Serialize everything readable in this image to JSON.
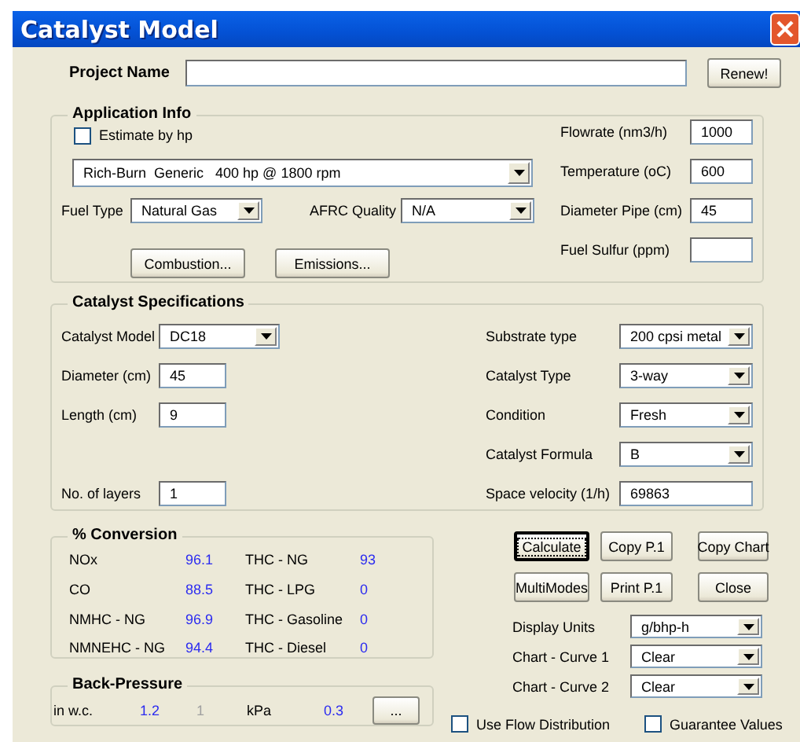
{
  "window": {
    "title": "Catalyst Model"
  },
  "project": {
    "label": "Project Name",
    "button": "Renew!"
  },
  "application_info": {
    "title": "Application Info",
    "estimate_by_hp": {
      "label": "Estimate by hp",
      "checked": false
    },
    "engine": {
      "value": "Rich-Burn  Generic   400 hp @ 1800 rpm"
    },
    "fuel_type": {
      "label": "Fuel Type",
      "value": "Natural Gas"
    },
    "afrc_quality": {
      "label": "AFRC Quality",
      "value": "N/A"
    },
    "buttons": [
      "Combustion...",
      "Emissions..."
    ],
    "fields": [
      {
        "label": "Flowrate (nm3/h)",
        "value": "1000"
      },
      {
        "label": "Temperature (oC)",
        "value": "600"
      },
      {
        "label": "Diameter Pipe (cm)",
        "value": "45"
      },
      {
        "label": "Fuel Sulfur (ppm)"
      }
    ]
  },
  "catalyst_specifications": {
    "title": "Catalyst Specifications",
    "left": [
      {
        "kind": "combo",
        "label": "Catalyst Model",
        "value": "DC18"
      },
      {
        "kind": "field",
        "label": "Diameter (cm)",
        "value": "45"
      },
      {
        "kind": "field",
        "label": "Length (cm)",
        "value": "9"
      },
      {
        "kind": "field",
        "label": "No. of layers",
        "value": "1"
      }
    ],
    "right": [
      {
        "kind": "combo",
        "label": "Substrate type",
        "value": "200 cpsi metal"
      },
      {
        "kind": "combo",
        "label": "Catalyst Type",
        "value": "3-way"
      },
      {
        "kind": "combo",
        "label": "Condition",
        "value": "Fresh"
      },
      {
        "kind": "combo",
        "label": "Catalyst Formula",
        "value": "B"
      },
      {
        "kind": "field",
        "label": "Space velocity (1/h)",
        "value": "69863"
      }
    ]
  },
  "conversion": {
    "title": "% Conversion",
    "items": [
      {
        "name": "NOx",
        "value": "96.1"
      },
      {
        "name": "THC - NG",
        "value": "93"
      },
      {
        "name": "CO",
        "value": "88.5"
      },
      {
        "name": "THC - LPG",
        "value": "0"
      },
      {
        "name": "NMHC - NG",
        "value": "96.9"
      },
      {
        "name": "THC - Gasoline",
        "value": "0"
      },
      {
        "name": "NMNEHC - NG",
        "value": "94.4"
      },
      {
        "name": "THC - Diesel",
        "value": "0"
      }
    ]
  },
  "back_pressure": {
    "title": "Back-Pressure",
    "readings": [
      {
        "unit": "in w.c.",
        "value": "1.2",
        "disabled": false
      },
      {
        "value": "1",
        "disabled": true
      },
      {
        "unit": "kPa",
        "value": "0.3",
        "disabled": false
      }
    ],
    "button": "..."
  },
  "actions": {
    "buttons": [
      {
        "label": "Calculate",
        "default": true
      },
      {
        "label": "Copy P.1",
        "default": false
      },
      {
        "label": "Copy Chart",
        "default": false
      },
      {
        "label": "MultiModes",
        "default": false
      },
      {
        "label": "Print P.1",
        "default": false
      },
      {
        "label": "Close",
        "default": false
      }
    ]
  },
  "chart_options": [
    {
      "label": "Display Units",
      "value": "g/bhp-h"
    },
    {
      "label": "Chart - Curve 1",
      "value": "Clear"
    },
    {
      "label": "Chart - Curve 2",
      "value": "Clear"
    }
  ],
  "options": [
    {
      "label": "Use Flow Distribution",
      "checked": false
    },
    {
      "label": "Guarantee Values",
      "checked": false
    }
  ]
}
